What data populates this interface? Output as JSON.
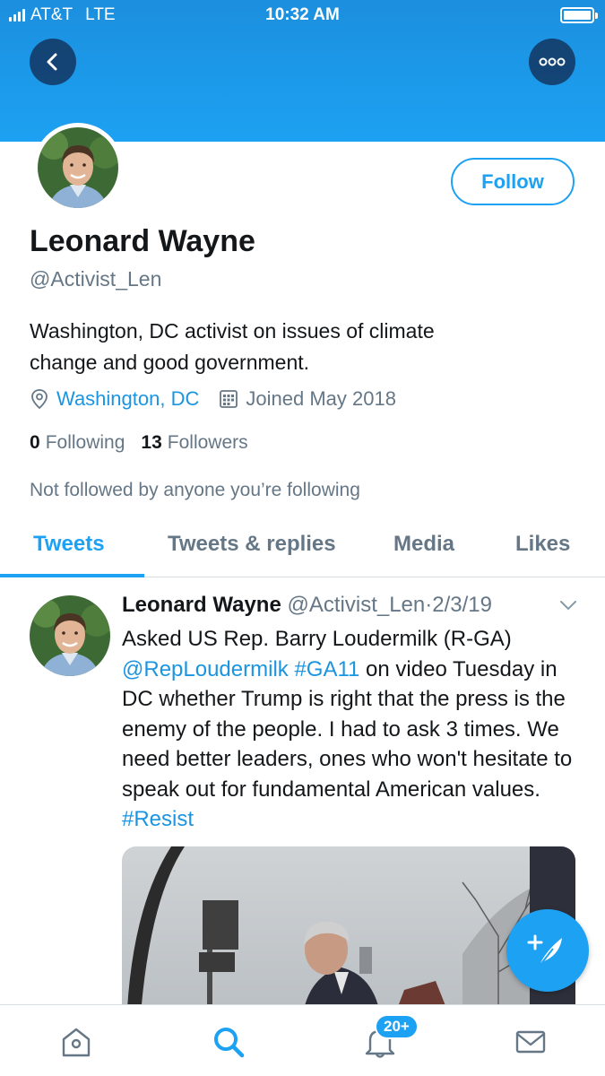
{
  "status_bar": {
    "carrier": "AT&T",
    "network": "LTE",
    "time": "10:32 AM"
  },
  "header": {
    "back_icon": "chevron-left-icon",
    "more_icon": "more-dots-icon"
  },
  "profile": {
    "display_name": "Leonard Wayne",
    "handle": "@Activist_Len",
    "follow_label": "Follow",
    "bio_line1": "Washington, DC activist on issues of climate",
    "bio_line2": "change and good government.",
    "location": "Washington, DC",
    "joined": "Joined May 2018",
    "following_count": "0",
    "following_label": "Following",
    "followers_count": "13",
    "followers_label": "Followers",
    "not_followed": "Not followed by anyone you’re following"
  },
  "tabs": [
    {
      "label": "Tweets",
      "active": true
    },
    {
      "label": "Tweets & replies",
      "active": false
    },
    {
      "label": "Media",
      "active": false
    },
    {
      "label": "Likes",
      "active": false
    }
  ],
  "tweet": {
    "name": "Leonard Wayne",
    "handle": "@Activist_Len",
    "dot": "·",
    "date": "2/3/19",
    "text_1": "Asked US Rep. Barry Loudermilk (R-GA)",
    "mention": "@RepLoudermilk",
    "hashtag1": "#GA11",
    "text_2": " on video Tuesday in DC whether Trump is right that the press is the enemy of the people.  I had to ask 3 times.  We need better leaders, ones who won't hesitate to speak out for fundamental American values.  ",
    "hashtag2": "#Resist"
  },
  "bottom_nav": {
    "items": [
      "home-icon",
      "search-icon",
      "notifications-icon",
      "messages-icon"
    ],
    "notification_badge": "20+"
  },
  "colors": {
    "accent": "#1da1f2",
    "link": "#1b95e0",
    "secondary_text": "#657786"
  }
}
